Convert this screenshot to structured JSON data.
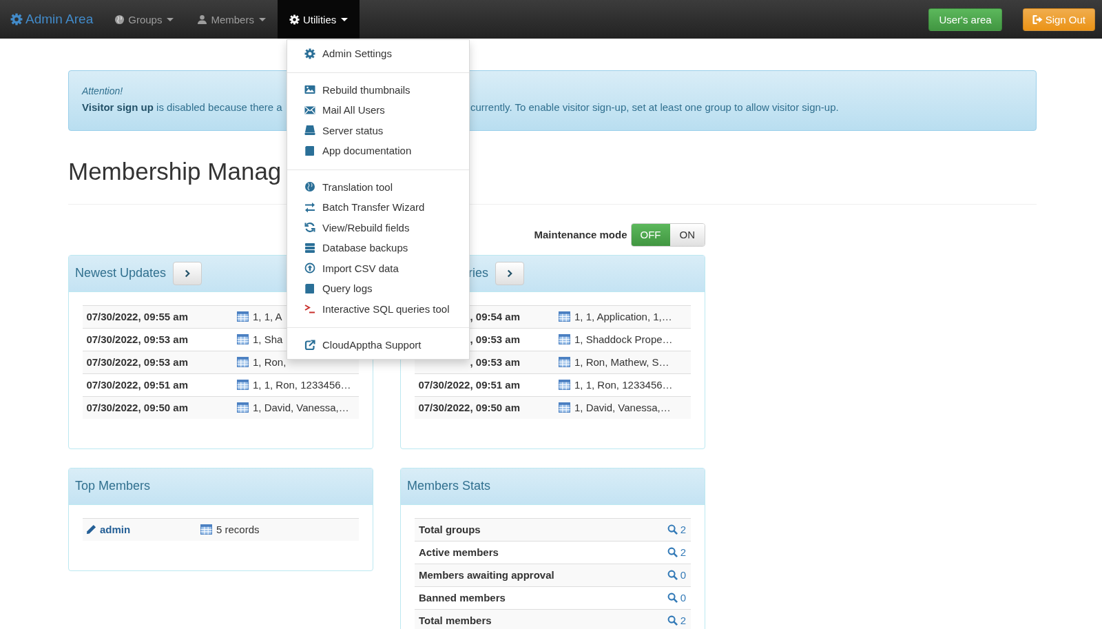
{
  "navbar": {
    "brand": "Admin Area",
    "items": [
      {
        "label": "Groups",
        "open": false
      },
      {
        "label": "Members",
        "open": false
      },
      {
        "label": "Utilities",
        "open": true
      }
    ],
    "buttons": [
      {
        "label": "User's area",
        "kind": "success"
      },
      {
        "label": "Sign Out",
        "kind": "warning"
      }
    ]
  },
  "utilities_menu": {
    "sections": [
      {
        "items": [
          "Admin Settings"
        ]
      },
      {
        "items": [
          "Rebuild thumbnails",
          "Mail All Users",
          "Server status",
          "App documentation"
        ]
      },
      {
        "items": [
          "Translation tool",
          "Batch Transfer Wizard",
          "View/Rebuild fields",
          "Database backups",
          "Import CSV data",
          "Query logs",
          "Interactive SQL queries tool"
        ]
      },
      {
        "items": [
          "CloudApptha Support"
        ]
      }
    ]
  },
  "alert": {
    "heading": "Attention!",
    "text_left": "**Visitor sign up** is disabled because there a",
    "text_right": "currently. To enable visitor sign-up, set at least one group to allow visitor sign-up."
  },
  "page_title": "Membership Manag",
  "maintenance_mode": {
    "label": "Maintenance mode",
    "options": [
      {
        "label": "OFF",
        "selected": true
      },
      {
        "label": "ON",
        "selected": false
      }
    ]
  },
  "panels": [
    {
      "kind": "updates",
      "title": "Newest Updates",
      "rows": [
        {
          "date": "07/30/2022, 09:55 am",
          "summary": "1, 1, A"
        },
        {
          "date": "07/30/2022, 09:53 am",
          "summary": "1, Sha"
        },
        {
          "date": "07/30/2022, 09:53 am",
          "summary": "1, Ron,"
        },
        {
          "date": "07/30/2022, 09:51 am",
          "summary": "1, 1, Ron, 1233456…"
        },
        {
          "date": "07/30/2022, 09:50 am",
          "summary": "1, David, Vanessa,…"
        }
      ]
    },
    {
      "kind": "updates",
      "title": "ries",
      "rows": [
        {
          "date": ", 09:54 am",
          "summary": "1, 1, Application, 1,…"
        },
        {
          "date": ", 09:53 am",
          "summary": "1, Shaddock Prope…"
        },
        {
          "date": ", 09:53 am",
          "summary": "1, Ron, Mathew, S…"
        },
        {
          "date": "07/30/2022, 09:51 am",
          "summary": "1, 1, Ron, 1233456…"
        },
        {
          "date": "07/30/2022, 09:50 am",
          "summary": "1, David, Vanessa,…"
        }
      ]
    },
    {
      "kind": "members",
      "title": "Top Members",
      "rows": [
        {
          "member": "admin",
          "records": "5 records"
        }
      ]
    },
    {
      "kind": "stats",
      "title": "Members Stats",
      "rows": [
        {
          "label": "Total groups",
          "count": "2"
        },
        {
          "label": "Active members",
          "count": "2"
        },
        {
          "label": "Members awaiting approval",
          "count": "0"
        },
        {
          "label": "Banned members",
          "count": "0"
        },
        {
          "label": "Total members",
          "count": "2"
        }
      ]
    }
  ]
}
